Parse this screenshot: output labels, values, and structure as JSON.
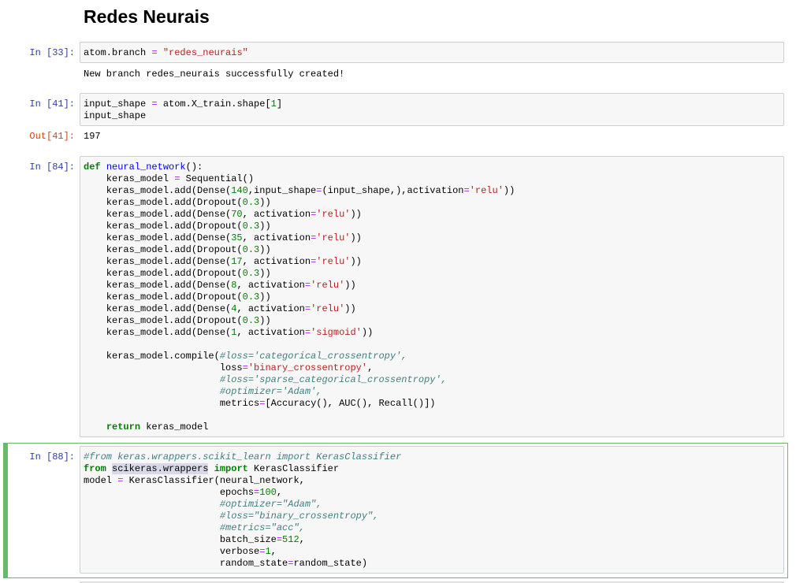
{
  "notebook": {
    "heading": "Redes Neurais",
    "cells": [
      {
        "prompt": "In [33]:",
        "code": [
          "atom.branch = \"redes_neurais\""
        ],
        "stdout": "New branch redes_neurais successfully created!"
      },
      {
        "prompt": "In [41]:",
        "code": [
          "input_shape = atom.X_train.shape[1]",
          "input_shape"
        ],
        "out_prompt": "Out[41]:",
        "out_value": "197"
      },
      {
        "prompt": "In [84]:",
        "code": [
          "def neural_network():",
          "    keras_model = Sequential()",
          "    keras_model.add(Dense(140,input_shape=(input_shape,),activation='relu'))",
          "    keras_model.add(Dropout(0.3))",
          "    keras_model.add(Dense(70, activation='relu'))",
          "    keras_model.add(Dropout(0.3))",
          "    keras_model.add(Dense(35, activation='relu'))",
          "    keras_model.add(Dropout(0.3))",
          "    keras_model.add(Dense(17, activation='relu'))",
          "    keras_model.add(Dropout(0.3))",
          "    keras_model.add(Dense(8, activation='relu'))",
          "    keras_model.add(Dropout(0.3))",
          "    keras_model.add(Dense(4, activation='relu'))",
          "    keras_model.add(Dropout(0.3))",
          "    keras_model.add(Dense(1, activation='sigmoid'))",
          "",
          "    keras_model.compile(#loss='categorical_crossentropy',",
          "                        loss='binary_crossentropy',",
          "                        #loss='sparse_categorical_crossentropy',",
          "                        #optimizer='Adam',",
          "                        metrics=[Accuracy(), AUC(), Recall()])",
          "",
          "    return keras_model"
        ]
      },
      {
        "prompt": "In [88]:",
        "selected": true,
        "code": [
          "#from keras.wrappers.scikit_learn import KerasClassifier",
          "from scikeras.wrappers import KerasClassifier",
          "model = KerasClassifier(neural_network,",
          "                        epochs=100,",
          "                        #optimizer=\"Adam\",",
          "                        #loss=\"binary_crossentropy\",",
          "                        #metrics=\"acc\",",
          "                        batch_size=512,",
          "                        verbose=1,",
          "                        random_state=random_state)"
        ],
        "highlight": "scikeras.wrappers"
      }
    ]
  },
  "colors": {
    "prompt_in": "#303f9f",
    "prompt_out": "#d84315",
    "selected_border": "#66bb6a",
    "cell_bg": "#f7f7f7"
  }
}
